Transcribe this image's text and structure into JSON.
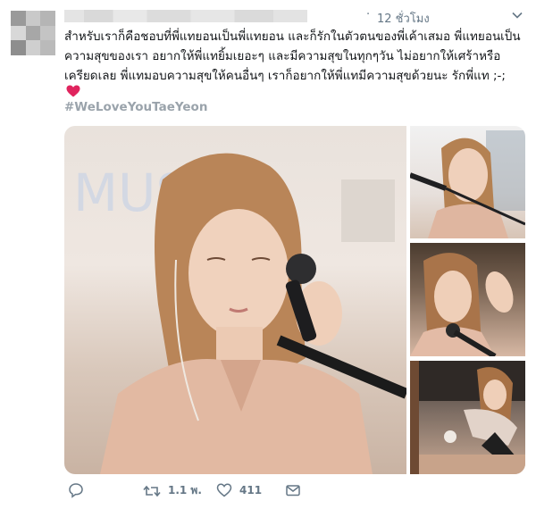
{
  "tweet": {
    "time": "12 ชั่วโมง",
    "dot": "·",
    "text_lines": [
      "สำหรับเราก็คือชอบที่พี่แทยอนเป็นพี่แทยอน และก็รักในตัวตนของพี่เค้าเสมอ พี่แทยอนเป็น",
      "ความสุขของเรา อยากให้พี่แทยิ้มเยอะๆ และมีความสุขในทุกๆวัน ไม่อยากให้เศร้าหรือ",
      "เครียดเลย พี่แทมอบความสุขให้คนอื่นๆ เราก็อยากให้พี่แทมีความสุขด้วยนะ รักพี่แท ;-;"
    ],
    "hashtag": "#WeLoveYouTaeYeon"
  },
  "actions": {
    "retweets": "1.1 พ.",
    "likes": "411"
  },
  "colors": {
    "heart": "#e0245e",
    "retweet": "#17bf63",
    "meta_text": "#657786",
    "hashtag": "#9aa3ab"
  }
}
